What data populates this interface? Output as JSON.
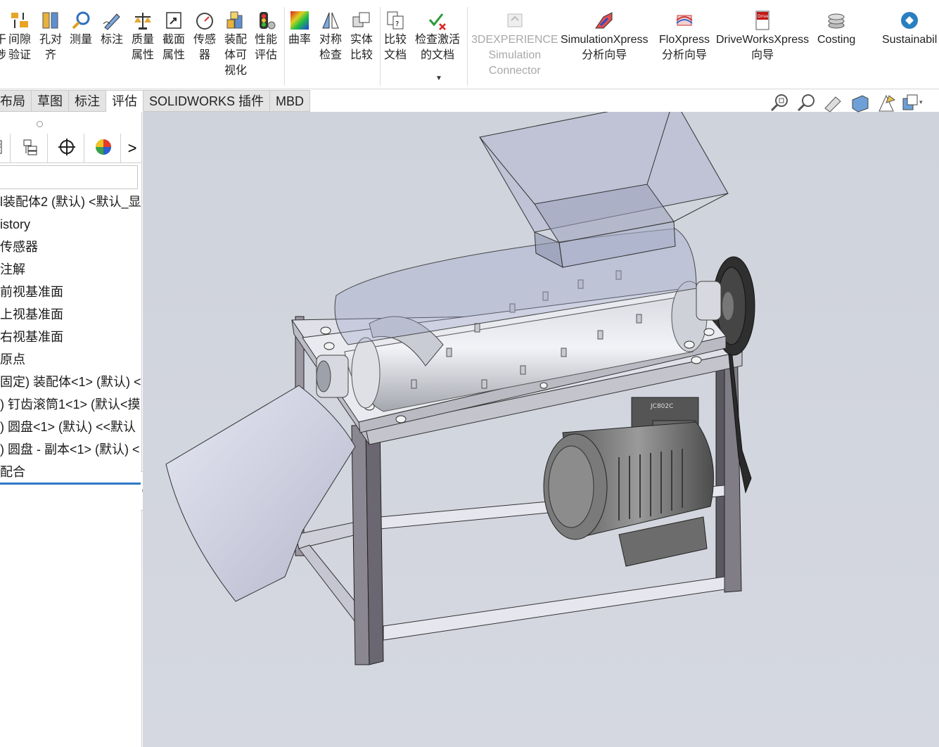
{
  "ribbon": {
    "buttons": [
      {
        "label": "间隙\n验证",
        "icon": "clearance-verification-icon"
      },
      {
        "label": "孔对\n齐",
        "icon": "hole-alignment-icon"
      },
      {
        "label": "测量",
        "icon": "measure-icon"
      },
      {
        "label": "标注",
        "icon": "markup-icon"
      },
      {
        "label": "质量\n属性",
        "icon": "mass-properties-icon"
      },
      {
        "label": "截面\n属性",
        "icon": "section-properties-icon"
      },
      {
        "label": "传感\n器",
        "icon": "sensor-icon"
      },
      {
        "label": "装配\n体可\n视化",
        "icon": "assembly-visualization-icon"
      },
      {
        "label": "性能\n评估",
        "icon": "performance-evaluation-icon"
      },
      {
        "label": "曲率",
        "icon": "curvature-icon"
      },
      {
        "label": "对称\n检查",
        "icon": "symmetry-check-icon"
      },
      {
        "label": "实体\n比较",
        "icon": "compare-bodies-icon"
      },
      {
        "label": "比较\n文档",
        "icon": "compare-documents-icon"
      },
      {
        "label": "检查激活\n的文档",
        "icon": "check-active-document-icon"
      },
      {
        "label": "3DEXPERIENCE\nSimulation\nConnector",
        "icon": "3dexperience-connector-icon",
        "disabled": true
      },
      {
        "label": "SimulationXpress\n分析向导",
        "icon": "simulationxpress-icon"
      },
      {
        "label": "FloXpress\n分析向导",
        "icon": "floxpress-icon"
      },
      {
        "label": "DriveWorksXpress\n向导",
        "icon": "driveworksxpress-icon"
      },
      {
        "label": "Costing",
        "icon": "costing-icon"
      },
      {
        "label": "Sustainabil",
        "icon": "sustainability-icon"
      }
    ],
    "truncated_left_label": "\n"
  },
  "tabs": [
    {
      "label": "布局",
      "active": false
    },
    {
      "label": "草图",
      "active": false
    },
    {
      "label": "标注",
      "active": false
    },
    {
      "label": "评估",
      "active": true
    },
    {
      "label": "SOLIDWORKS 插件",
      "active": false
    },
    {
      "label": "MBD",
      "active": false
    }
  ],
  "panel": {
    "tabs": [
      "feature-manager-icon",
      "property-manager-icon",
      "configuration-manager-icon",
      "appearance-icon"
    ],
    "expand_label": ">",
    "tree": [
      "l装配体2 (默认) <默认_显",
      "istory",
      "传感器",
      "注解",
      "前视基准面",
      "上视基准面",
      "右视基准面",
      "原点",
      "固定) 装配体<1> (默认) <",
      ") 钉齿滚筒1<1> (默认<摸",
      ") 圆盘<1> (默认) <<默认",
      ") 圆盘 - 副本<1> (默认) <",
      "配合"
    ]
  },
  "viewport": {
    "hud": [
      "zoom-to-fit-icon",
      "zoom-area-icon",
      "previous-view-icon",
      "section-view-icon",
      "view-orientation-icon",
      "display-style-icon"
    ],
    "background": "#d2d5dd",
    "motor_label": "JC802C"
  }
}
